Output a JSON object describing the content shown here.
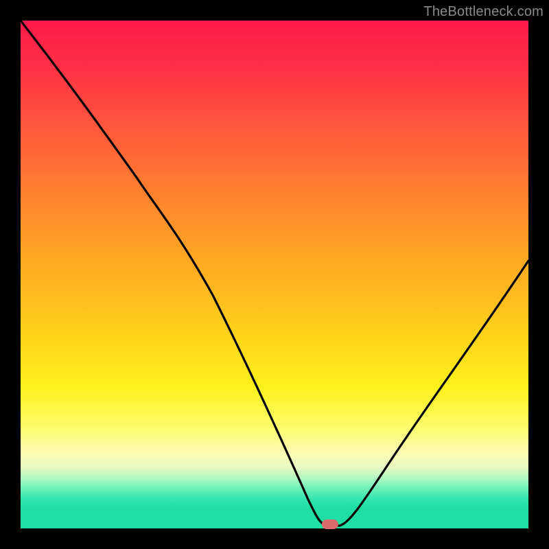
{
  "watermark": "TheBottleneck.com",
  "colors": {
    "background": "#000000",
    "gradient_top": "#ff1a4b",
    "gradient_mid": "#ffd31a",
    "gradient_bottom": "#1fdfa6",
    "line": "#000000",
    "marker": "#db6b6d",
    "watermark_text": "#8a8a8a"
  },
  "chart_data": {
    "type": "line",
    "title": "",
    "xlabel": "",
    "ylabel": "",
    "xlim": [
      0,
      100
    ],
    "ylim": [
      0,
      100
    ],
    "grid": false,
    "legend": false,
    "x": [
      0,
      5,
      10,
      15,
      20,
      25,
      30,
      35,
      40,
      45,
      50,
      55,
      58,
      60,
      62,
      65,
      70,
      75,
      80,
      85,
      90,
      95,
      100
    ],
    "values": [
      100,
      93,
      86,
      79,
      73,
      68,
      60,
      50,
      40,
      29,
      18,
      8,
      2,
      0,
      0,
      2,
      10,
      18,
      26,
      34,
      41,
      47,
      53
    ],
    "marker": {
      "x": 61,
      "y": 0
    },
    "note": "Values estimated from pixel positions; y is percent of plot height from bottom."
  }
}
